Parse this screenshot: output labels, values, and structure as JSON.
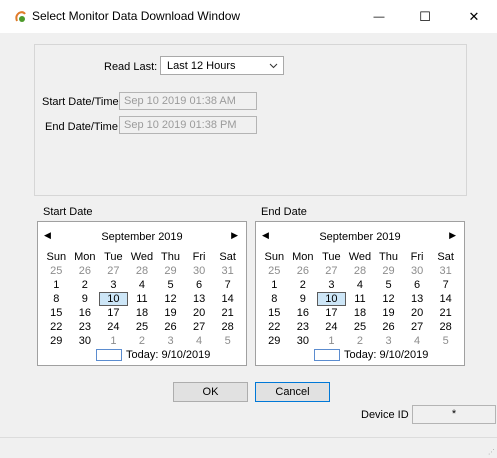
{
  "window": {
    "title": "Select Monitor Data Download Window",
    "minimize_glyph": "—",
    "maximize_glyph": "☐",
    "close_glyph": "✕"
  },
  "read": {
    "read_last_label": "Read Last:",
    "read_last_value": "Last 12 Hours",
    "start_datetime_label": "Start Date/Time",
    "start_datetime_value": "Sep 10 2019  01:38 AM",
    "end_datetime_label": "End Date/Time",
    "end_datetime_value": "Sep 10 2019  01:38 PM"
  },
  "start_calendar": {
    "label": "Start Date",
    "month_title": "September 2019",
    "weekdays": [
      "Sun",
      "Mon",
      "Tue",
      "Wed",
      "Thu",
      "Fri",
      "Sat"
    ],
    "weeks": [
      [
        "25",
        "26",
        "27",
        "28",
        "29",
        "30",
        "31"
      ],
      [
        "1",
        "2",
        "3",
        "4",
        "5",
        "6",
        "7"
      ],
      [
        "8",
        "9",
        "10",
        "11",
        "12",
        "13",
        "14"
      ],
      [
        "15",
        "16",
        "17",
        "18",
        "19",
        "20",
        "21"
      ],
      [
        "22",
        "23",
        "24",
        "25",
        "26",
        "27",
        "28"
      ],
      [
        "29",
        "30",
        "1",
        "2",
        "3",
        "4",
        "5"
      ]
    ],
    "selected_day": "10",
    "today_label": "Today: 9/10/2019"
  },
  "end_calendar": {
    "label": "End Date",
    "month_title": "September 2019",
    "weekdays": [
      "Sun",
      "Mon",
      "Tue",
      "Wed",
      "Thu",
      "Fri",
      "Sat"
    ],
    "weeks": [
      [
        "25",
        "26",
        "27",
        "28",
        "29",
        "30",
        "31"
      ],
      [
        "1",
        "2",
        "3",
        "4",
        "5",
        "6",
        "7"
      ],
      [
        "8",
        "9",
        "10",
        "11",
        "12",
        "13",
        "14"
      ],
      [
        "15",
        "16",
        "17",
        "18",
        "19",
        "20",
        "21"
      ],
      [
        "22",
        "23",
        "24",
        "25",
        "26",
        "27",
        "28"
      ],
      [
        "29",
        "30",
        "1",
        "2",
        "3",
        "4",
        "5"
      ]
    ],
    "selected_day": "10",
    "today_label": "Today: 9/10/2019"
  },
  "buttons": {
    "ok": "OK",
    "cancel": "Cancel"
  },
  "device": {
    "label": "Device ID",
    "value": "*"
  },
  "colors": {
    "today_box": "#5b8ccf",
    "selection": "#cde6f7",
    "focus_border": "#0078d7"
  }
}
